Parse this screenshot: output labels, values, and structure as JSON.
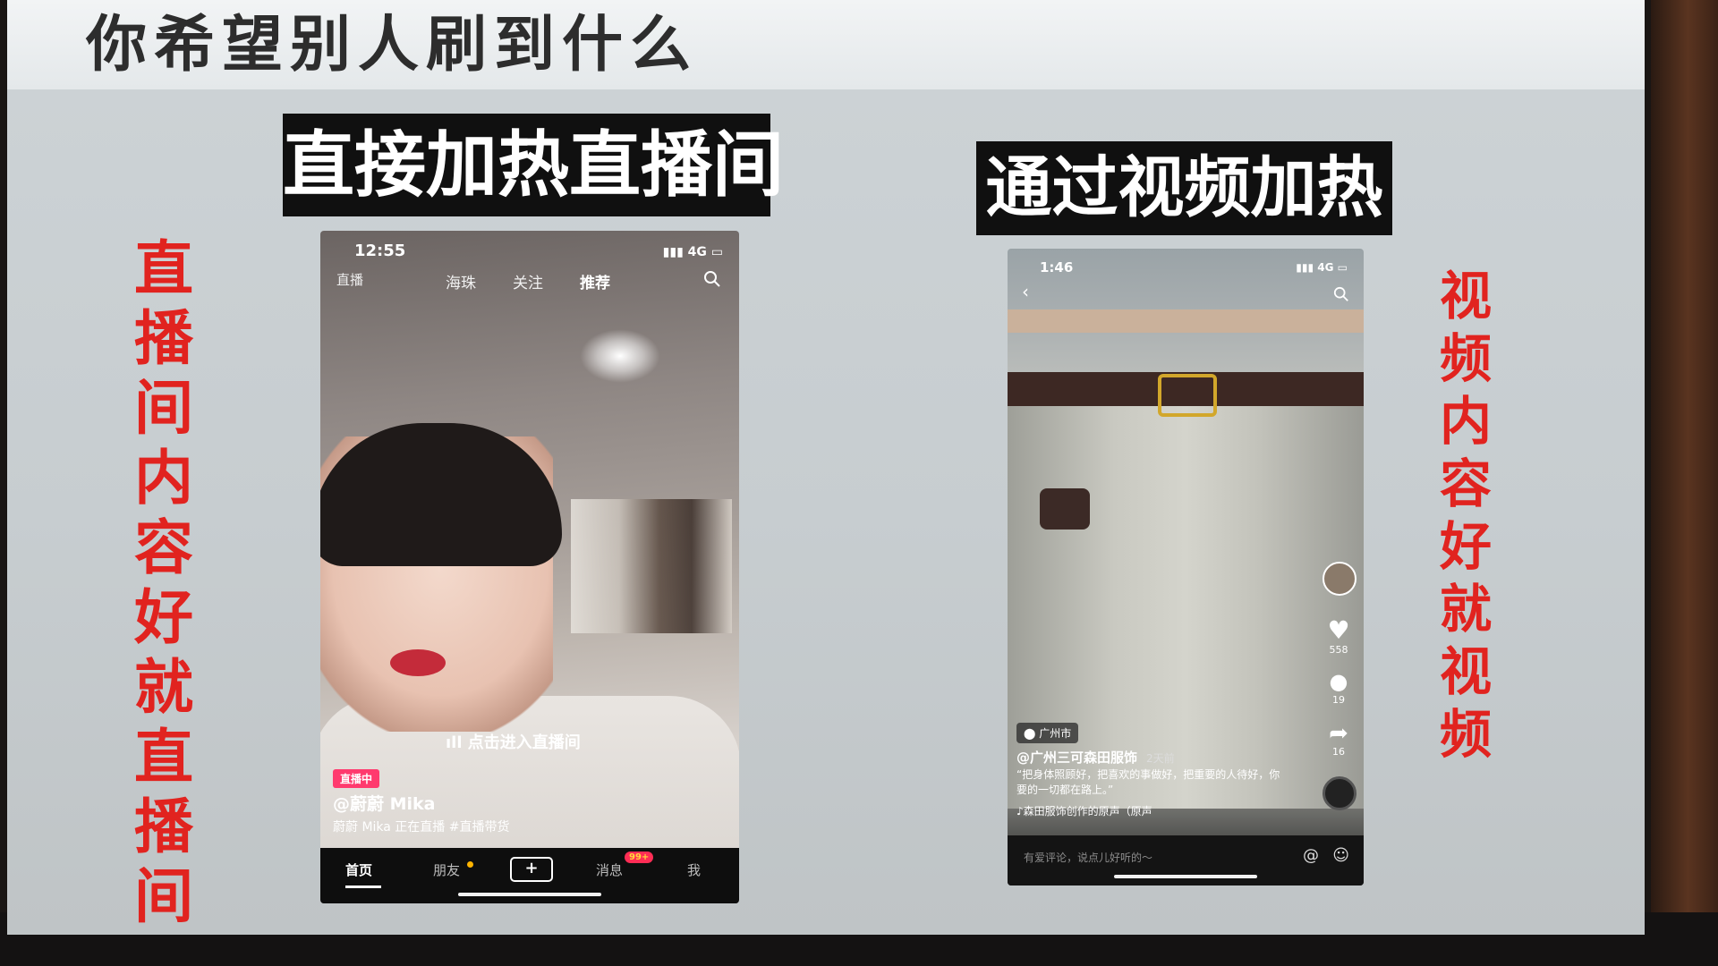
{
  "slide": {
    "title": "你希望别人刷到什么",
    "left_heading": "直接加热直播间",
    "right_heading": "通过视频加热",
    "left_side_text": [
      "直",
      "播",
      "间",
      "内",
      "容",
      "好",
      "就",
      "直",
      "播",
      "间"
    ],
    "right_side_text": [
      "视",
      "频",
      "内",
      "容",
      "好",
      "就",
      "视",
      "频"
    ]
  },
  "phone_live": {
    "time": "12:55",
    "network": "4G",
    "live_icon_label": "直播",
    "tabs": [
      {
        "label": "海珠"
      },
      {
        "label": "关注"
      },
      {
        "label": "推荐"
      }
    ],
    "enter_prompt": "点击进入直播间",
    "live_badge": "直播中",
    "username": "@蔚蔚 Mika",
    "description": "蔚蔚 Mika 正在直播 #直播带货",
    "nav": {
      "home": "首页",
      "friends": "朋友",
      "plus": "+",
      "messages": "消息",
      "messages_badge": "99+",
      "me": "我"
    }
  },
  "phone_video": {
    "time": "1:46",
    "network": "4G",
    "likes": "558",
    "comments": "19",
    "shares": "16",
    "location": "广州市",
    "author": "@广州三可森田服饰",
    "posted": "2天前",
    "caption": "“把身体照顾好，把喜欢的事做好，把重要的人待好，你要的一切都在路上。”",
    "music": "♪森田服饰创作的原声（原声",
    "comment_placeholder": "有爱评论，说点儿好听的～",
    "at_icon": "@"
  },
  "colors": {
    "accent_red": "#e1231f",
    "heading_box": "#101010",
    "live_badge": "#ff3a6e"
  }
}
